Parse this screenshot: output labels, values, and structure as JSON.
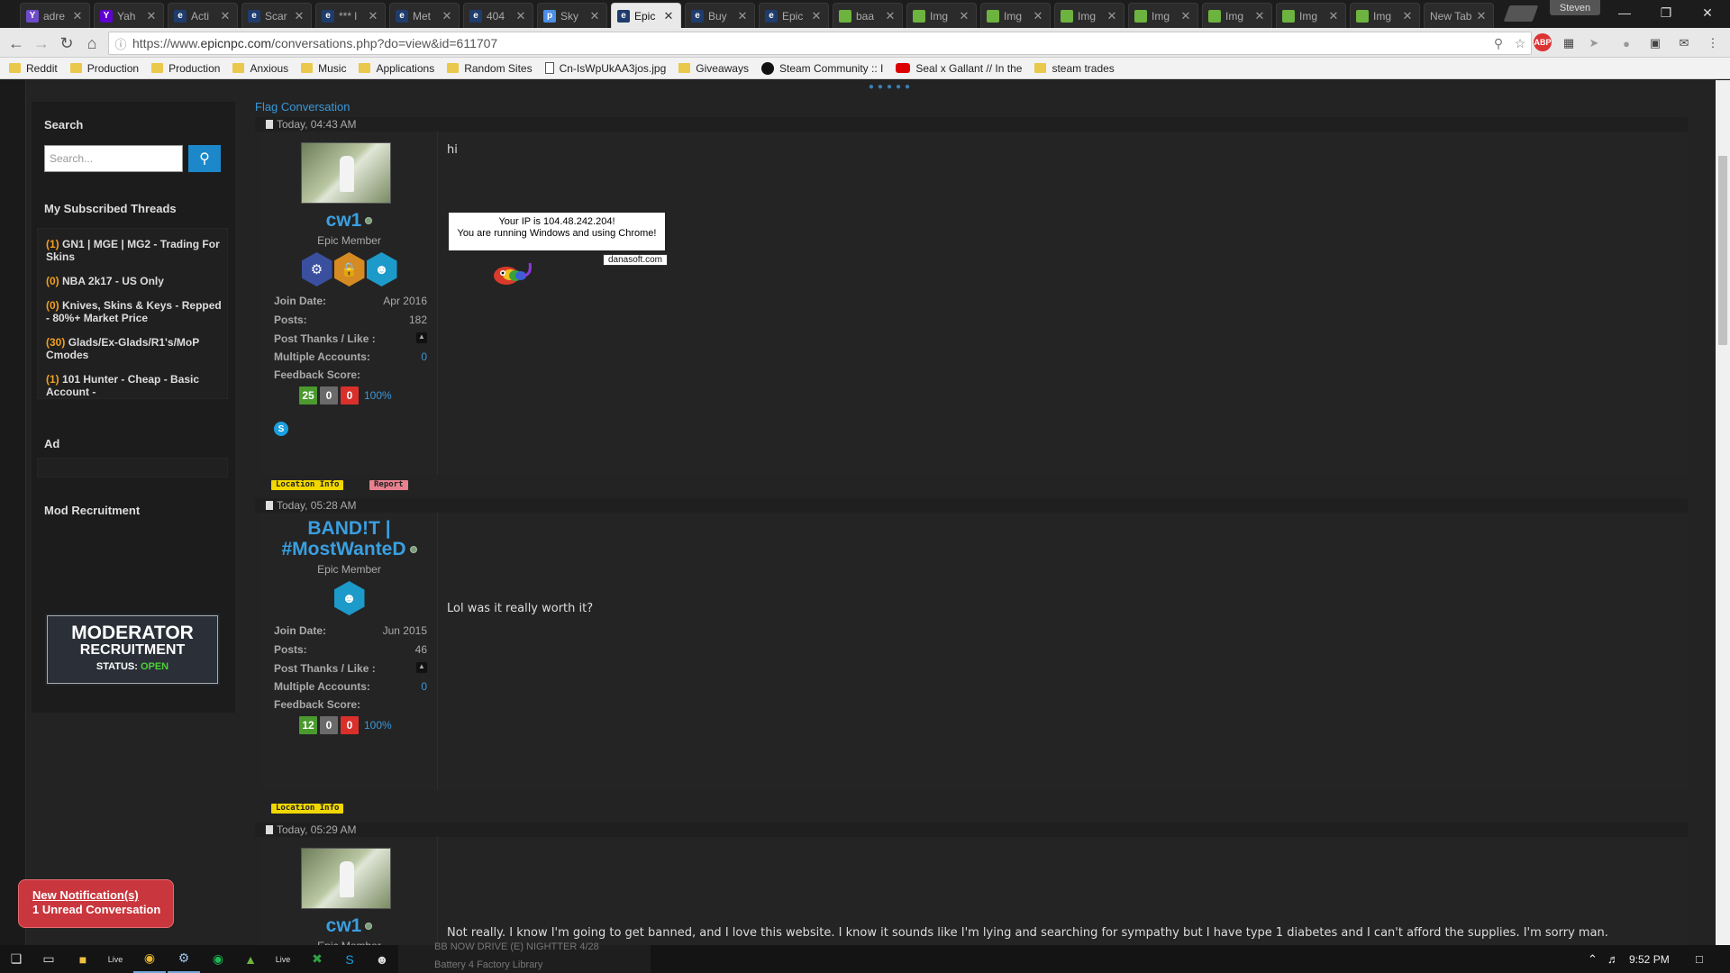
{
  "browser": {
    "tabs": [
      {
        "title": "adre",
        "color": "#6e4cc9",
        "glyph": "Y"
      },
      {
        "title": "Yah",
        "color": "#5f01d1",
        "glyph": "Y"
      },
      {
        "title": "Acti",
        "color": "#1f3c6d",
        "glyph": "e"
      },
      {
        "title": "Scar",
        "color": "#1f3c6d",
        "glyph": "e"
      },
      {
        "title": "*** l",
        "color": "#1f3c6d",
        "glyph": "e"
      },
      {
        "title": "Met",
        "color": "#1f3c6d",
        "glyph": "e"
      },
      {
        "title": "404",
        "color": "#1f3c6d",
        "glyph": "e"
      },
      {
        "title": "Sky",
        "color": "#4d8fe8",
        "glyph": "p"
      },
      {
        "title": "Epic",
        "color": "#1f3c6d",
        "glyph": "e"
      },
      {
        "title": "Buy",
        "color": "#1f3c6d",
        "glyph": "e"
      },
      {
        "title": "Epic",
        "color": "#1f3c6d",
        "glyph": "e"
      },
      {
        "title": "baa",
        "color": "#6db33f",
        "glyph": ""
      },
      {
        "title": "Img",
        "color": "#6db33f",
        "glyph": ""
      },
      {
        "title": "Img",
        "color": "#6db33f",
        "glyph": ""
      },
      {
        "title": "Img",
        "color": "#6db33f",
        "glyph": ""
      },
      {
        "title": "Img",
        "color": "#6db33f",
        "glyph": ""
      },
      {
        "title": "Img",
        "color": "#6db33f",
        "glyph": ""
      },
      {
        "title": "Img",
        "color": "#6db33f",
        "glyph": ""
      },
      {
        "title": "Img",
        "color": "#6db33f",
        "glyph": ""
      },
      {
        "title": "New Tab",
        "color": "",
        "glyph": ""
      }
    ],
    "active_tab": 8,
    "profile_name": "Steven",
    "url_prefix": "https://www.",
    "url_domain": "epicnpc.com",
    "url_path": "/conversations.php?do=view&id=611707",
    "bookmarks": [
      {
        "label": "Reddit",
        "type": "folder"
      },
      {
        "label": "Production",
        "type": "folder"
      },
      {
        "label": "Production",
        "type": "folder"
      },
      {
        "label": "Anxious",
        "type": "folder"
      },
      {
        "label": "Music",
        "type": "folder"
      },
      {
        "label": "Applications",
        "type": "folder"
      },
      {
        "label": "Random Sites",
        "type": "folder"
      },
      {
        "label": "Cn-IsWpUkAA3jos.jpg",
        "type": "page"
      },
      {
        "label": "Giveaways",
        "type": "folder"
      },
      {
        "label": "Steam Community :: I",
        "type": "steam"
      },
      {
        "label": "Seal x Gallant // In the",
        "type": "youtube"
      },
      {
        "label": "steam trades",
        "type": "folder"
      }
    ]
  },
  "sidebar": {
    "search_title": "Search",
    "search_placeholder": "Search...",
    "subscribed_title": "My Subscribed Threads",
    "threads": [
      {
        "count": "(1)",
        "title": "GN1 | MGE | MG2 - Trading For Skins"
      },
      {
        "count": "(0)",
        "title": "NBA 2k17 - US Only"
      },
      {
        "count": "(0)",
        "title": "Knives, Skins & Keys - Repped - 80%+ Market Price"
      },
      {
        "count": "(30)",
        "title": "Glads/Ex-Glads/R1's/MoP Cmodes"
      },
      {
        "count": "(1)",
        "title": "101 Hunter - Cheap - Basic Account -"
      }
    ],
    "ad_title": "Ad",
    "mod_title": "Mod Recruitment",
    "mod_banner": {
      "line1": "MODERATOR",
      "line2": "RECRUITMENT",
      "status_label": "STATUS:",
      "status_value": "OPEN"
    }
  },
  "main": {
    "flag_link": "Flag Conversation",
    "posts": [
      {
        "time": "Today, 04:43 AM",
        "username": "cw1",
        "role": "Epic Member",
        "join_label": "Join Date:",
        "join_value": "Apr 2016",
        "posts_label": "Posts:",
        "posts_value": "182",
        "thanks_label": "Post Thanks / Like :",
        "multi_label": "Multiple Accounts:",
        "multi_value": "0",
        "feedback_label": "Feedback Score:",
        "fb_pos": "25",
        "fb_neu": "0",
        "fb_neg": "0",
        "fb_pct": "100%",
        "message": "hi",
        "ip_line1": "Your IP is 104.48.242.204!",
        "ip_line2": "You are running Windows and using Chrome!",
        "ip_site": "danasoft.com",
        "tags": [
          "Location Info",
          "Report"
        ]
      },
      {
        "time": "Today, 05:28 AM",
        "username_line1": "BAND!T |",
        "username_line2": "#MostWanteD",
        "role": "Epic Member",
        "join_label": "Join Date:",
        "join_value": "Jun 2015",
        "posts_label": "Posts:",
        "posts_value": "46",
        "thanks_label": "Post Thanks / Like :",
        "multi_label": "Multiple Accounts:",
        "multi_value": "0",
        "feedback_label": "Feedback Score:",
        "fb_pos": "12",
        "fb_neu": "0",
        "fb_neg": "0",
        "fb_pct": "100%",
        "message": "Lol was it really worth it?",
        "tags": [
          "Location Info"
        ]
      },
      {
        "time": "Today, 05:29 AM",
        "username": "cw1",
        "role": "Epic Member",
        "message": "Not really. I know I'm going to get banned, and I love this website. I know it sounds like I'm lying and searching for sympathy but I have type 1 diabetes and I can't afford the supplies. I'm sorry man."
      }
    ]
  },
  "notification": {
    "line1": "New Notification(s)",
    "line2": "1 Unread Conversation"
  },
  "taskbar": {
    "clock": "9:52 PM",
    "background_items": [
      "BB NOW DRIVE (E) NIGHTTER 4/28",
      "Battery 4 Factory Library"
    ]
  },
  "colors": {
    "accent": "#3a97d9",
    "search_button": "#1c87c9",
    "positive": "#4a9a2e",
    "neutral": "#6a6a6a",
    "negative": "#d9302c",
    "tag_location": "#f1d700",
    "tag_report": "#e8818f"
  }
}
